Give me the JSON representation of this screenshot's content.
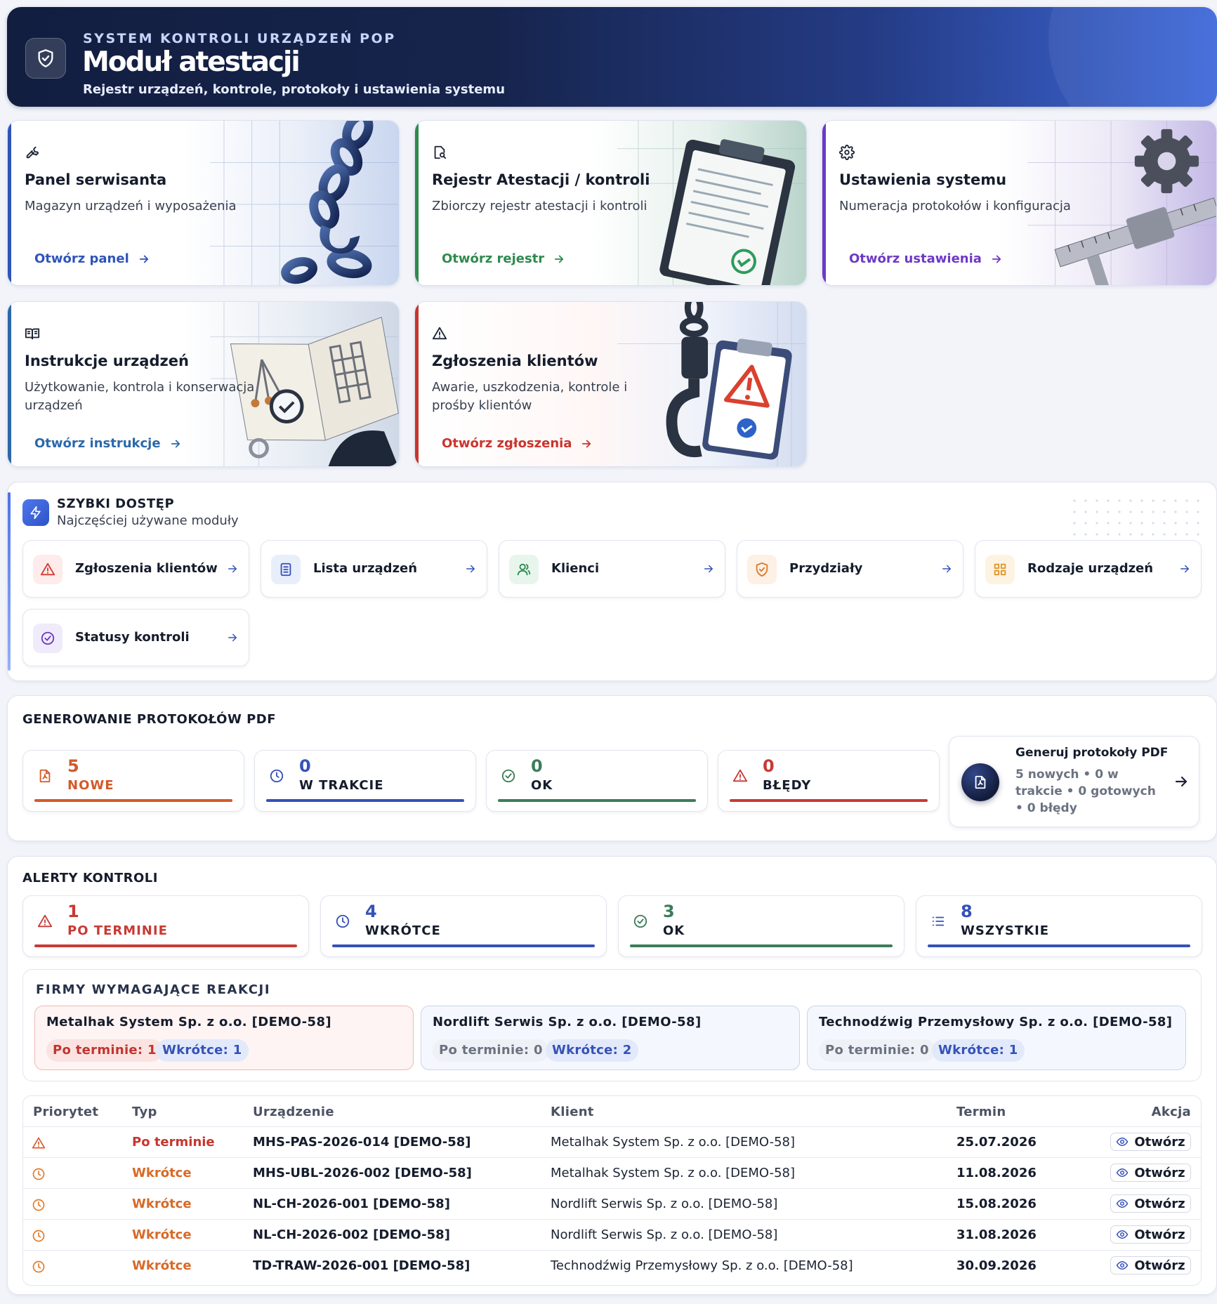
{
  "header": {
    "kicker": "SYSTEM KONTROLI URZĄDZEŃ POP",
    "title": "Moduł atestacji",
    "subtitle": "Rejestr urządzeń, kontrole, protokoły i ustawienia systemu"
  },
  "modules": [
    {
      "title": "Panel serwisanta",
      "desc": "Magazyn urządzeń i wyposażenia",
      "link": "Otwórz panel",
      "icon": "wrench-icon",
      "color": "#2f54b8"
    },
    {
      "title": "Rejestr Atestacji / kontroli",
      "desc": "Zbiorczy rejestr atestacji i kontroli",
      "link": "Otwórz rejestr",
      "icon": "document-search-icon",
      "color": "#2f8a4f"
    },
    {
      "title": "Ustawienia systemu",
      "desc": "Numeracja protokołów i konfiguracja",
      "link": "Otwórz ustawienia",
      "icon": "gear-icon",
      "color": "#6d39c6"
    },
    {
      "title": "Instrukcje urządzeń",
      "desc": "Użytkowanie, kontrola i konserwacja urządzeń",
      "link": "Otwórz instrukcje",
      "icon": "book-icon",
      "color": "#2c68a8"
    },
    {
      "title": "Zgłoszenia klientów",
      "desc": "Awarie, uszkodzenia, kontrole i prośby klientów",
      "link": "Otwórz zgłoszenia",
      "icon": "warning-icon",
      "color": "#c8352e"
    }
  ],
  "quick_access": {
    "title": "SZYBKI DOSTĘP",
    "subtitle": "Najczęściej używane moduły",
    "items": [
      {
        "label": "Zgłoszenia klientów",
        "icon": "warning-icon"
      },
      {
        "label": "Lista urządzeń",
        "icon": "list-icon"
      },
      {
        "label": "Klienci",
        "icon": "users-icon"
      },
      {
        "label": "Przydziały",
        "icon": "shield-check-icon"
      },
      {
        "label": "Rodzaje urządzeń",
        "icon": "grid-icon"
      },
      {
        "label": "Statusy kontroli",
        "icon": "check-circle-icon"
      }
    ]
  },
  "pdf": {
    "title": "GENEROWANIE PROTOKOŁÓW PDF",
    "stats": [
      {
        "value": "5",
        "label": "NOWE",
        "color": "#d35a2a",
        "icon": "pdf-file-icon"
      },
      {
        "value": "0",
        "label": "W TRAKCIE",
        "color": "#3552b8",
        "icon": "clock-icon"
      },
      {
        "value": "0",
        "label": "OK",
        "color": "#3c7d5a",
        "icon": "check-circle-icon"
      },
      {
        "value": "0",
        "label": "BŁĘDY",
        "color": "#c83a35",
        "icon": "warning-icon"
      }
    ],
    "generate": {
      "title": "Generuj protokoły PDF",
      "desc": "5 nowych • 0 w trakcie • 0 gotowych • 0 błędy"
    }
  },
  "alerts": {
    "title": "ALERTY KONTROLI",
    "stats": [
      {
        "value": "1",
        "label": "PO TERMINIE",
        "color": "#c83a35",
        "label_color": "#c83a35",
        "icon": "warning-icon"
      },
      {
        "value": "4",
        "label": "WKRÓTCE",
        "color": "#3552b8",
        "label_color": "#151c2c",
        "icon": "clock-icon"
      },
      {
        "value": "3",
        "label": "OK",
        "color": "#3c7d5a",
        "label_color": "#151c2c",
        "icon": "check-circle-icon"
      },
      {
        "value": "8",
        "label": "WSZYSTKIE",
        "color": "#3552b8",
        "label_color": "#151c2c",
        "icon": "list-icon"
      }
    ],
    "firms_title": "FIRMY WYMAGAJĄCE REAKCJI",
    "firms": [
      {
        "name": "Metalhak System Sp. z o.o. [DEMO-58]",
        "overdue": "Po terminie: 1",
        "soon": "Wkrótce: 1"
      },
      {
        "name": "Nordlift Serwis Sp. z o.o. [DEMO-58]",
        "overdue": "Po terminie: 0",
        "soon": "Wkrótce: 2"
      },
      {
        "name": "Technodźwig Przemysłowy Sp. z o.o. [DEMO-58]",
        "overdue": "Po terminie: 0",
        "soon": "Wkrótce: 1"
      }
    ],
    "table": {
      "headers": {
        "priority": "Priorytet",
        "type": "Typ",
        "device": "Urządzenie",
        "client": "Klient",
        "due": "Termin",
        "action": "Akcja"
      },
      "rows": [
        {
          "type": "Po terminie",
          "device": "MHS-PAS-2026-014 [DEMO-58]",
          "client": "Metalhak System Sp. z o.o. [DEMO-58]",
          "due": "25.07.2026",
          "action": "Otwórz"
        },
        {
          "type": "Wkrótce",
          "device": "MHS-UBL-2026-002 [DEMO-58]",
          "client": "Metalhak System Sp. z o.o. [DEMO-58]",
          "due": "11.08.2026",
          "action": "Otwórz"
        },
        {
          "type": "Wkrótce",
          "device": "NL-CH-2026-001 [DEMO-58]",
          "client": "Nordlift Serwis Sp. z o.o. [DEMO-58]",
          "due": "15.08.2026",
          "action": "Otwórz"
        },
        {
          "type": "Wkrótce",
          "device": "NL-CH-2026-002 [DEMO-58]",
          "client": "Nordlift Serwis Sp. z o.o. [DEMO-58]",
          "due": "31.08.2026",
          "action": "Otwórz"
        },
        {
          "type": "Wkrótce",
          "device": "TD-TRAW-2026-001 [DEMO-58]",
          "client": "Technodźwig Przemysłowy Sp. z o.o. [DEMO-58]",
          "due": "30.09.2026",
          "action": "Otwórz"
        }
      ]
    }
  }
}
